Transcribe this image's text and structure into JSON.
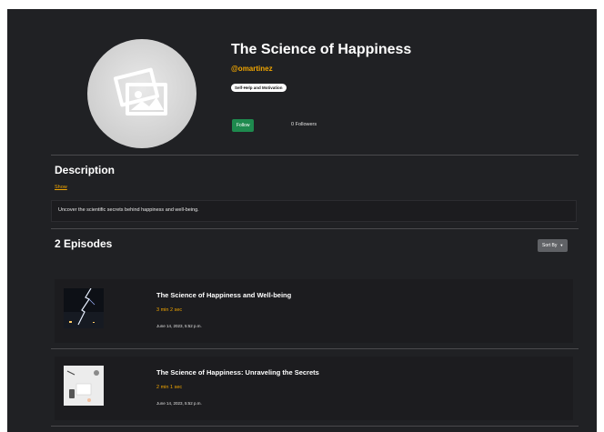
{
  "podcast": {
    "title": "The Science of Happiness",
    "handle": "@omartinez",
    "category": "Self-Help and Motivation",
    "follow_label": "Follow",
    "followers_text": "0 Followers",
    "cover_icon": "image-placeholder-icon"
  },
  "description": {
    "heading": "Description",
    "toggle_label": "Show",
    "text": "Uncover the scientific secrets behind happiness and well-being."
  },
  "episodes_section": {
    "heading": "2 Episodes",
    "sort_label": "Sort By"
  },
  "episodes": [
    {
      "title": "The Science of Happiness and Well-being",
      "duration": "3 min 2 sec",
      "date": "June 14, 2023, 5:52 p.m."
    },
    {
      "title": "The Science of Happiness: Unraveling the Secrets",
      "duration": "2 min 1 sec",
      "date": "June 14, 2023, 5:52 p.m."
    }
  ],
  "colors": {
    "background": "#202124",
    "accent": "#f0a500",
    "follow_button": "#1e8a4e",
    "sort_button": "#606266"
  }
}
